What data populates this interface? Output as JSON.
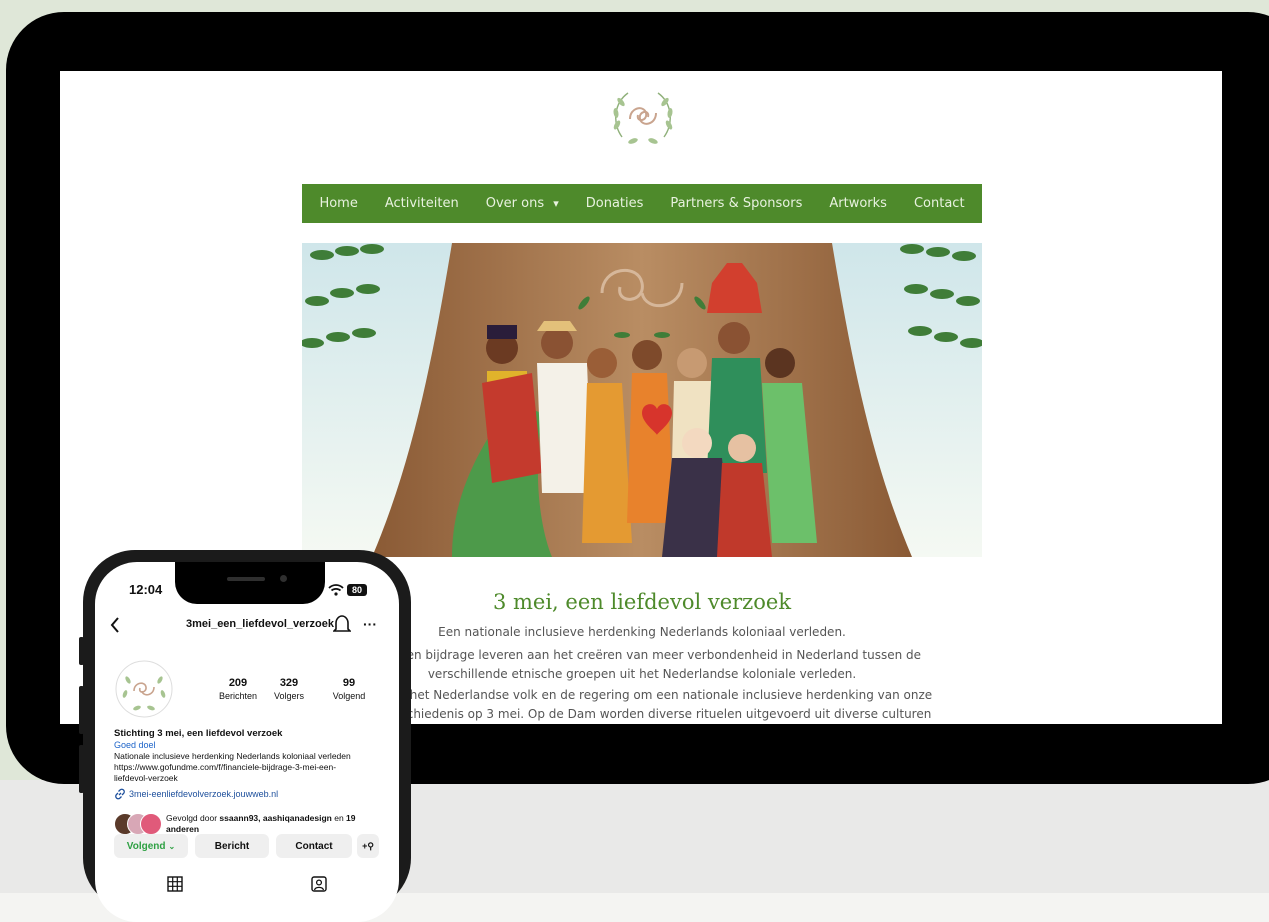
{
  "website": {
    "nav": [
      "Home",
      "Activiteiten",
      "Over ons",
      "Donaties",
      "Partners & Sponsors",
      "Artworks",
      "Contact"
    ],
    "dropdown_glyph": "▾",
    "title": "3 mei, een liefdevol verzoek",
    "subtitle": "Een nationale inclusieve herdenking Nederlands koloniaal verleden.",
    "paragraph1_line1": "is om een bijdrage leveren aan het creëren van meer verbondenheid in Nederland tussen de",
    "paragraph1_line2": "verschillende etnische groepen uit het Nederlandse koloniale verleden.",
    "paragraph2_line1": "zoek aan het Nederlandse volk en de regering om een nationale inclusieve herdenking van onze",
    "paragraph2_line2": "niale geschiedenis op 3 mei. Op de Dam worden diverse rituelen uitgevoerd uit diverse culturen",
    "colors": {
      "green": "#4e8a2b",
      "nav_text": "#e8f2df"
    }
  },
  "phone": {
    "time": "12:04",
    "battery": "80",
    "username": "3mei_een_liefdevol_verzoek",
    "stats": [
      {
        "value": "209",
        "label": "Berichten"
      },
      {
        "value": "329",
        "label": "Volgers"
      },
      {
        "value": "99",
        "label": "Volgend"
      }
    ],
    "name": "Stichting 3 mei, een liefdevol verzoek",
    "category": "Goed doel",
    "bio_line1": "Nationale inclusieve herdenking Nederlands koloniaal verleden",
    "bio_line2": "https://www.gofundme.com/f/financiele-bijdrage-3-mei-een-",
    "bio_line3": "liefdevol-verzoek",
    "link": "3mei-eenliefdevolverzoek.jouwweb.nl",
    "followed_prefix": "Gevolgd door ",
    "followed_names": "ssaann93, aashiqanadesign",
    "followed_mid": " en ",
    "followed_count": "19",
    "followed_suffix": "anderen",
    "buttons": {
      "following": "Volgend",
      "message": "Bericht",
      "contact": "Contact",
      "add_person": "+"
    },
    "icons": {
      "back": "chevron-left-icon",
      "bell": "bell-icon",
      "more": "more-icon",
      "grid": "grid-icon",
      "tagged": "tagged-icon"
    }
  }
}
